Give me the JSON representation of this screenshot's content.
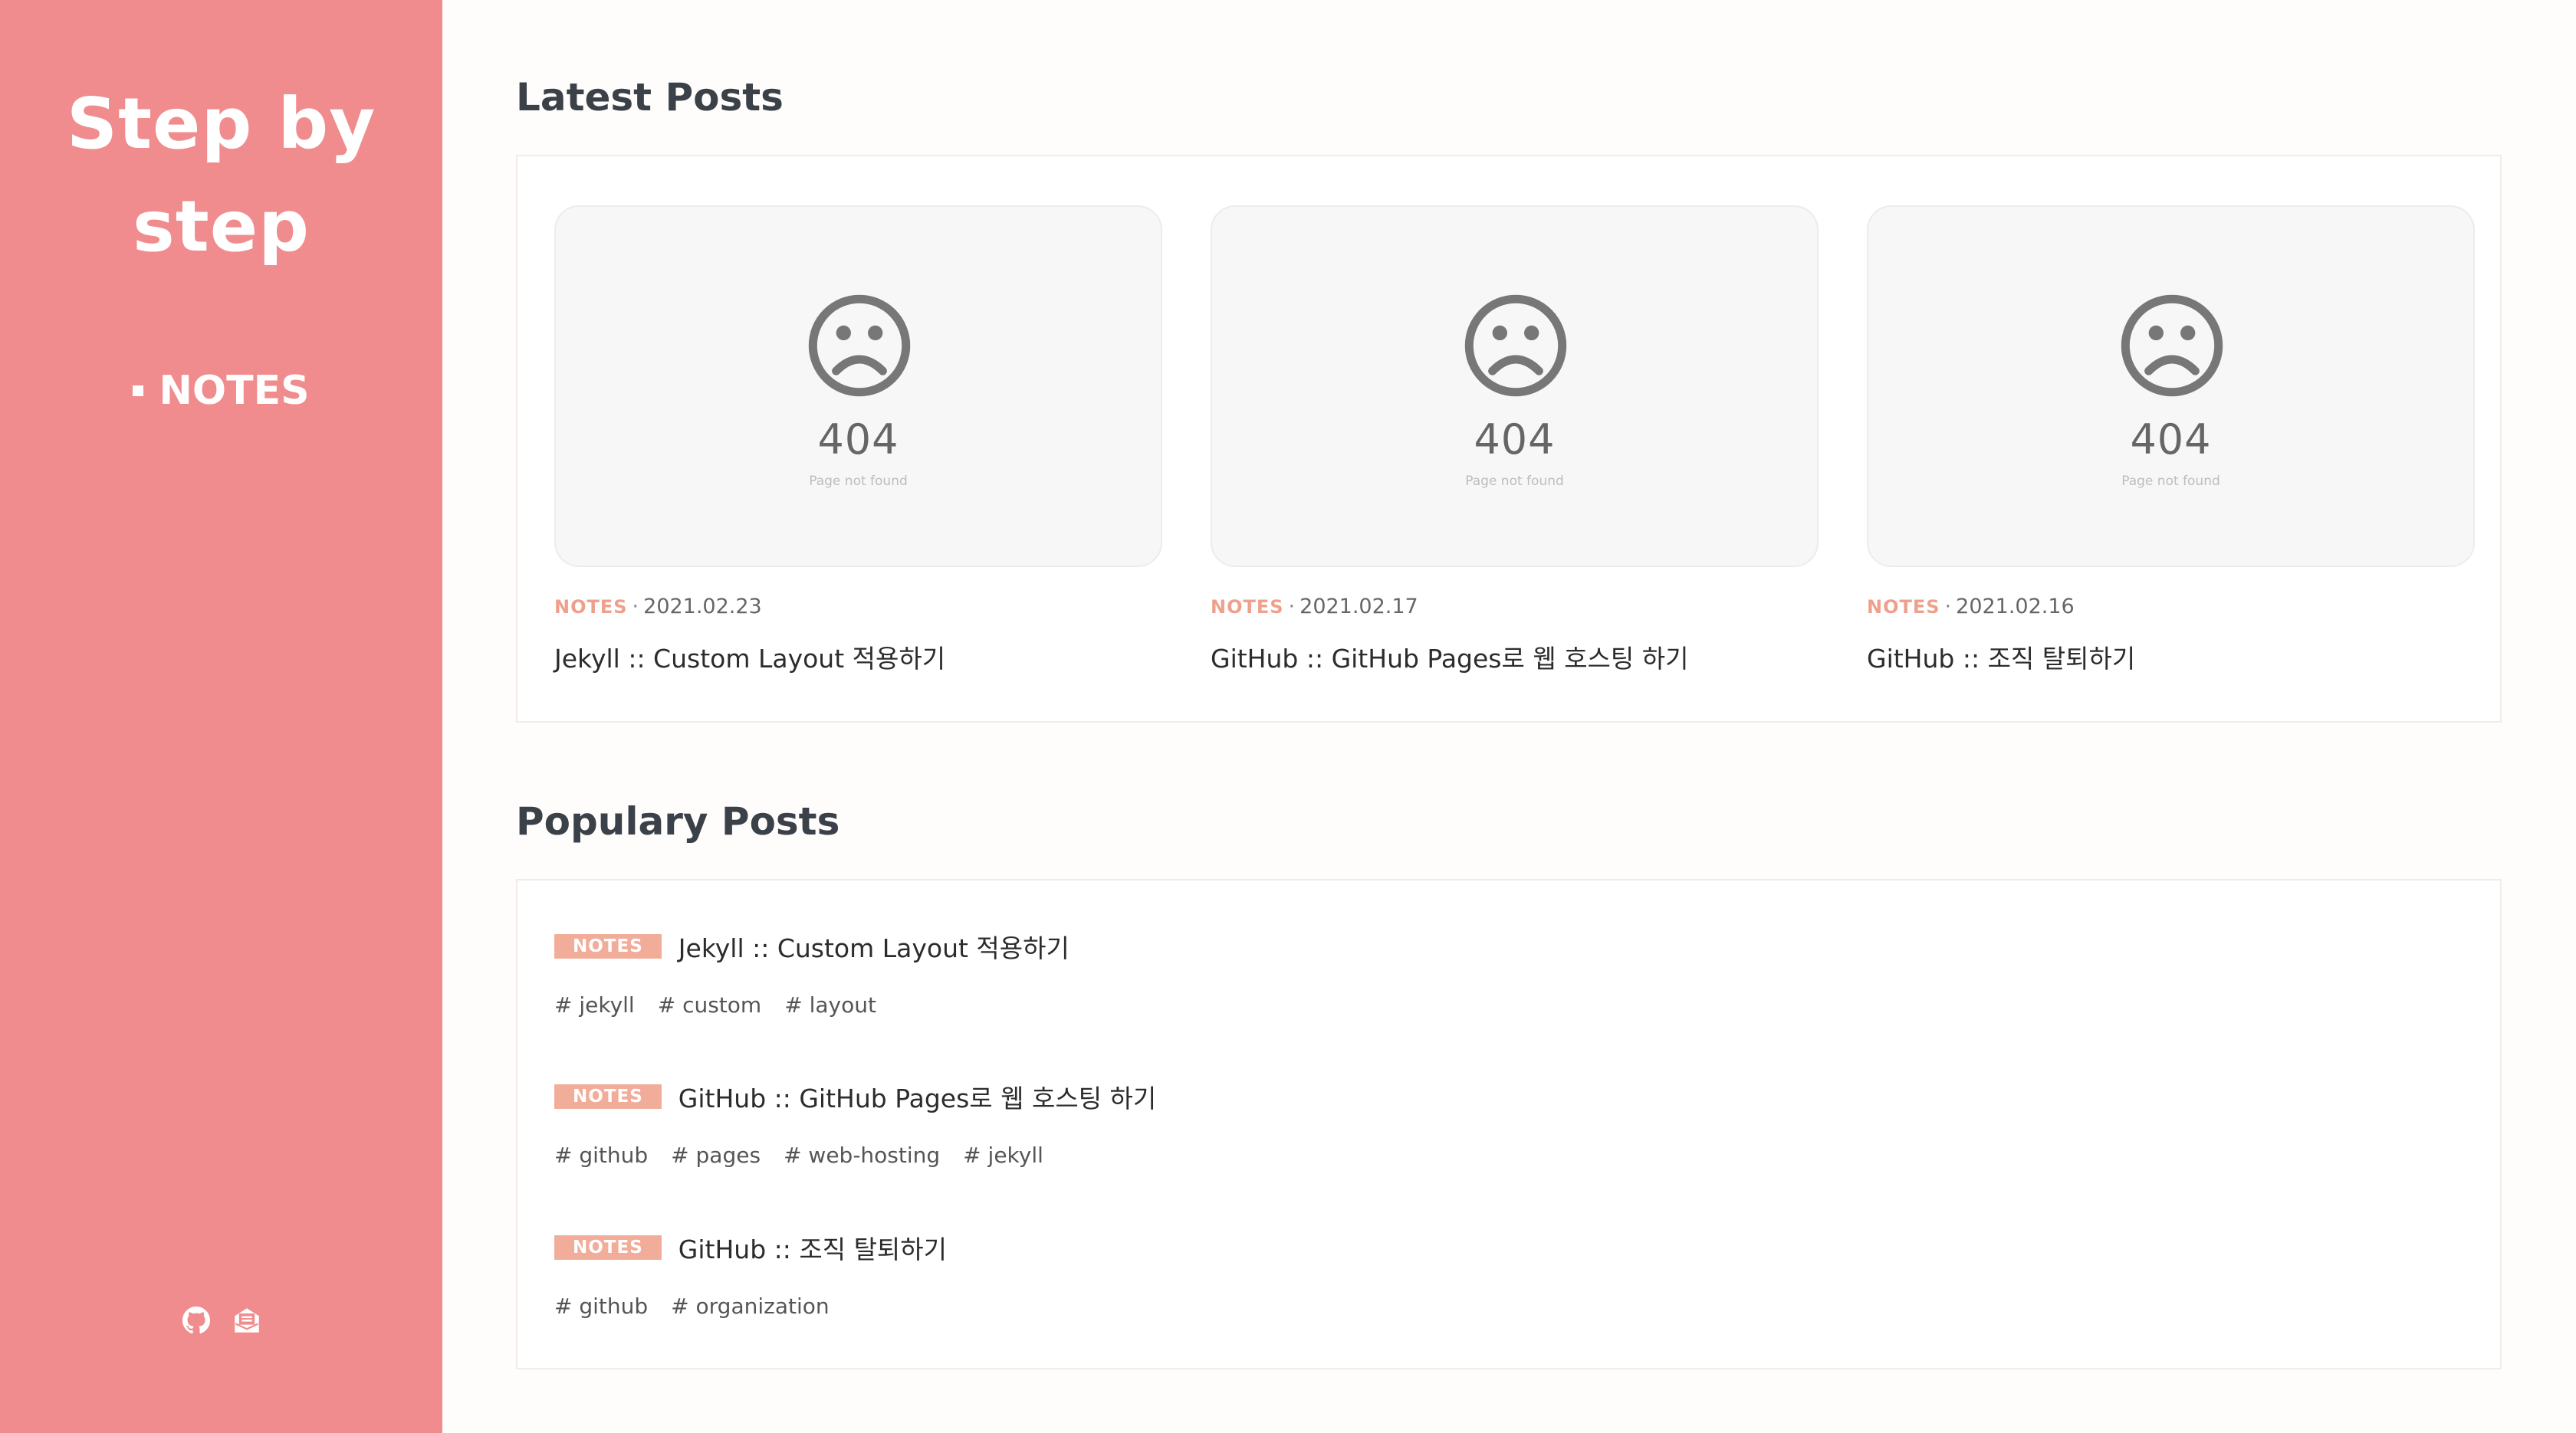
{
  "site": {
    "title_line1": "Step by",
    "title_line2": "step"
  },
  "nav": {
    "items": [
      {
        "label": "NOTES"
      }
    ]
  },
  "social": {
    "icons": [
      "github-icon",
      "mail-icon"
    ]
  },
  "latest": {
    "title": "Latest Posts",
    "cards": [
      {
        "thumb_code": "404",
        "thumb_message": "Page not found",
        "category": "NOTES",
        "date": "2021.02.23",
        "title": "Jekyll :: Custom Layout 적용하기"
      },
      {
        "thumb_code": "404",
        "thumb_message": "Page not found",
        "category": "NOTES",
        "date": "2021.02.17",
        "title": "GitHub :: GitHub Pages로 웹 호스팅 하기"
      },
      {
        "thumb_code": "404",
        "thumb_message": "Page not found",
        "category": "NOTES",
        "date": "2021.02.16",
        "title": "GitHub :: 조직 탈퇴하기"
      }
    ]
  },
  "popular": {
    "title": "Populary Posts",
    "items": [
      {
        "category": "NOTES",
        "title": "Jekyll :: Custom Layout 적용하기",
        "tags": [
          "# jekyll",
          "# custom",
          "# layout"
        ]
      },
      {
        "category": "NOTES",
        "title": "GitHub :: GitHub Pages로 웹 호스팅 하기",
        "tags": [
          "# github",
          "# pages",
          "# web-hosting",
          "# jekyll"
        ]
      },
      {
        "category": "NOTES",
        "title": "GitHub :: 조직 탈퇴하기",
        "tags": [
          "# github",
          "# organization"
        ]
      }
    ]
  },
  "colors": {
    "sidebar": "#f08c8d",
    "accent": "#eea08c",
    "badge": "#f2ad9a"
  }
}
